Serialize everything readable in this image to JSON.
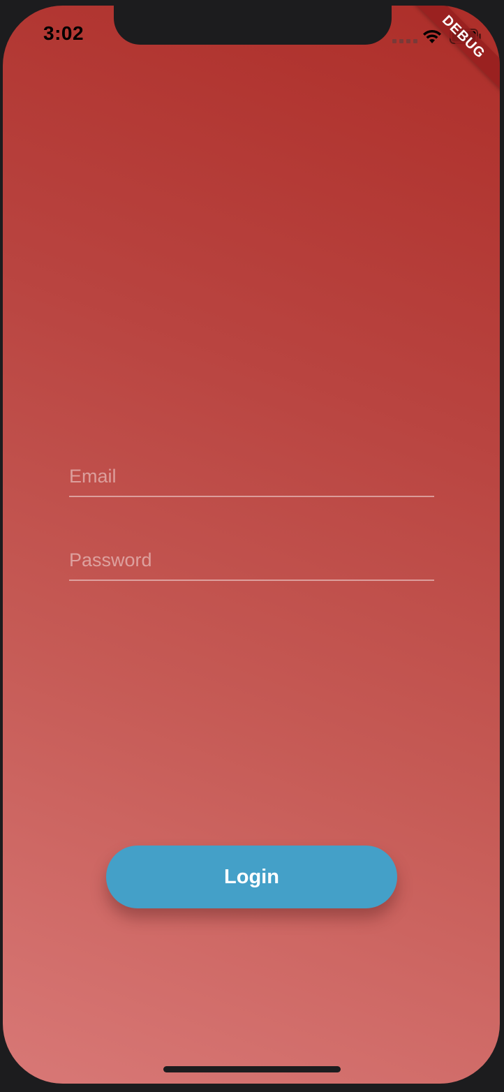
{
  "status_bar": {
    "time": "3:02",
    "icons": [
      "signal-icon",
      "wifi-icon",
      "battery-icon"
    ]
  },
  "debug_banner": {
    "label": "DEBUG"
  },
  "form": {
    "email": {
      "placeholder": "Email",
      "value": ""
    },
    "password": {
      "placeholder": "Password",
      "value": ""
    }
  },
  "login_button": {
    "label": "Login"
  },
  "colors": {
    "background_top": "#ad2e29",
    "background_bottom": "#d87876",
    "button": "#44a0c8",
    "text": "#ffffff"
  }
}
